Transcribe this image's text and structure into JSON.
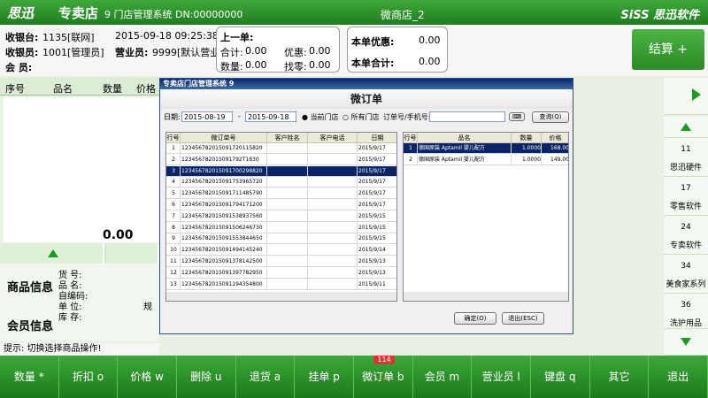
{
  "topbar": {
    "logo": "思迅",
    "edition": "专卖店",
    "system": "9  门店管理系统 DN:00000000",
    "shop": "微商店_2",
    "brand": "SiSS 思迅软件"
  },
  "info": {
    "cashier_label": "收银台:",
    "cashier_value": "1135[联网]",
    "datetime": "2015-09-18 09:25:38",
    "operator_label": "收银员:",
    "operator_value": "1001[管理员]",
    "sales_label": "营业员:",
    "sales_value": "9999[默认营业员]",
    "member_label": "会  员:",
    "last_title": "上一单:",
    "total_label": "合计:",
    "total_value": "0.00",
    "discount_label": "优惠:",
    "discount_value": "0.00",
    "qty_label": "数量:",
    "qty_value": "0.00",
    "change_label": "找零:",
    "change_value": "0.00",
    "cur_discount_label": "本单优惠:",
    "cur_discount_value": "0.00",
    "cur_total_label": "本单合计:",
    "cur_total_value": "0.00",
    "settle": "结算 +"
  },
  "grid": {
    "headers": [
      "序号",
      "品名",
      "数量",
      "价格"
    ],
    "total": "0.00"
  },
  "product": {
    "title": "商品信息",
    "labels": [
      "货  号:",
      "品  名:",
      "自编码:",
      "单  位:",
      "库  存:"
    ],
    "spec_label": "规",
    "member_title": "会员信息"
  },
  "hint": "提示: 切换选择商品操作!",
  "right_panel": [
    {
      "num": "11",
      "name": "思迅硬件"
    },
    {
      "num": "17",
      "name": "零售软件"
    },
    {
      "num": "24",
      "name": "专卖软件"
    },
    {
      "num": "34",
      "name": "美食家系列"
    },
    {
      "num": "36",
      "name": "洗护用品"
    }
  ],
  "dialog": {
    "window_title": "专卖店门店管理系统 9",
    "title": "微订单",
    "date_label": "日期:",
    "date_from": "2015-08-19",
    "date_sep": "-",
    "date_to": "2015-09-18",
    "radio_current": "当前门店",
    "radio_all": "所有门店",
    "order_label": "订单号/手机号:",
    "query_btn": "查询(Q)",
    "left_headers": [
      "行号",
      "微订单号",
      "客户姓名",
      "客户电话",
      "日期"
    ],
    "left_rows": [
      {
        "n": "1",
        "id": "123456782015091720115820",
        "name": "",
        "phone": "",
        "date": "2015/9/17"
      },
      {
        "n": "2",
        "id": "123456782015091792T1830",
        "name": "",
        "phone": "",
        "date": "2015/9/17"
      },
      {
        "n": "3",
        "id": "123456782015091700298820",
        "name": "",
        "phone": "",
        "date": "2015/9/17"
      },
      {
        "n": "4",
        "id": "123456782015091753965720",
        "name": "",
        "phone": "",
        "date": "2015/9/17"
      },
      {
        "n": "5",
        "id": "123456782015091711485790",
        "name": "",
        "phone": "",
        "date": "2015/9/17"
      },
      {
        "n": "6",
        "id": "123456782015091794171200",
        "name": "",
        "phone": "",
        "date": "2015/9/17"
      },
      {
        "n": "7",
        "id": "123456782015091538937560",
        "name": "",
        "phone": "",
        "date": "2015/9/15"
      },
      {
        "n": "8",
        "id": "123456782015091506246730",
        "name": "",
        "phone": "",
        "date": "2015/9/15"
      },
      {
        "n": "9",
        "id": "123456782015091553844650",
        "name": "",
        "phone": "",
        "date": "2015/9/15"
      },
      {
        "n": "10",
        "id": "123456782015091494145240",
        "name": "",
        "phone": "",
        "date": "2015/9/14"
      },
      {
        "n": "11",
        "id": "123456782015091378142500",
        "name": "",
        "phone": "",
        "date": "2015/9/13"
      },
      {
        "n": "12",
        "id": "123456782015091397782950",
        "name": "",
        "phone": "",
        "date": "2015/9/13"
      },
      {
        "n": "13",
        "id": "123456782015091194354800",
        "name": "",
        "phone": "",
        "date": "2015/9/11"
      }
    ],
    "right_headers": [
      "行号",
      "品名",
      "数量",
      "价格"
    ],
    "right_rows": [
      {
        "n": "1",
        "name": "德国原装 Aptamil 婴儿配方",
        "qty": "1.0000",
        "price": "168.00"
      },
      {
        "n": "2",
        "name": "德国原装 Aptamil 婴儿配方",
        "qty": "1.0000",
        "price": "149.00"
      }
    ],
    "ok_btn": "确定(O)",
    "exit_btn": "退出(ESC)"
  },
  "toolbar": [
    {
      "label": "数量 *",
      "name": "qty-button"
    },
    {
      "label": "折扣 o",
      "name": "discount-button"
    },
    {
      "label": "价格 w",
      "name": "price-button"
    },
    {
      "label": "删除 u",
      "name": "delete-button"
    },
    {
      "label": "退货 a",
      "name": "return-button"
    },
    {
      "label": "挂单 p",
      "name": "hold-button"
    },
    {
      "label": "微订单 b",
      "name": "micro-order-button"
    },
    {
      "label": "会员 m",
      "name": "member-button"
    },
    {
      "label": "营业员 l",
      "name": "salesperson-button"
    },
    {
      "label": "键盘 q",
      "name": "keyboard-button"
    },
    {
      "label": "其它",
      "name": "other-button"
    },
    {
      "label": "退出",
      "name": "exit-button"
    }
  ],
  "badge": "114",
  "colors": {
    "accent": "#1f8a1f",
    "selection": "#0a246a"
  }
}
